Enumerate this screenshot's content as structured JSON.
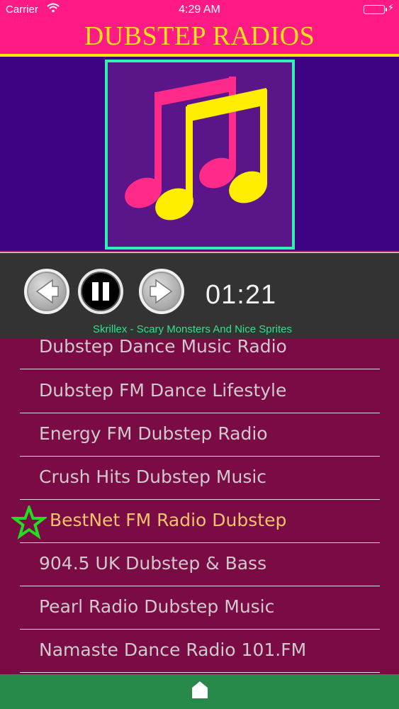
{
  "status": {
    "carrier": "Carrier",
    "time": "4:29 AM",
    "battery_fill": 1.0
  },
  "header": {
    "title": "DUBSTEP RADIOS"
  },
  "artwork": {
    "icon": "music-note-icon",
    "frame_color": "#2ef2b0",
    "bg_color": "#3e0382"
  },
  "player": {
    "prev_icon": "previous-icon",
    "pause_icon": "pause-icon",
    "next_icon": "next-icon",
    "elapsed": "01:21",
    "now_playing": "Skrillex - Scary Monsters And Nice Sprites"
  },
  "stations": [
    {
      "name": "Dubstep Dance Music Radio",
      "favorite": false
    },
    {
      "name": "Dubstep FM Dance Lifestyle",
      "favorite": false
    },
    {
      "name": "Energy FM Dubstep Radio",
      "favorite": false
    },
    {
      "name": "Crush Hits Dubstep Music",
      "favorite": false
    },
    {
      "name": "BestNet FM Radio Dubstep",
      "favorite": true
    },
    {
      "name": "904.5 UK Dubstep & Bass",
      "favorite": false
    },
    {
      "name": "Pearl Radio Dubstep Music",
      "favorite": false
    },
    {
      "name": "Namaste Dance Radio 101.FM",
      "favorite": false
    }
  ],
  "bottom_bar": {
    "home_icon": "home-icon"
  },
  "colors": {
    "header_bg": "#ff1a86",
    "title": "#ffe11a",
    "list_bg": "#7a0b44",
    "active_station": "#f3c46b",
    "star": "#22dd22",
    "bottom_bar": "#27894a"
  }
}
